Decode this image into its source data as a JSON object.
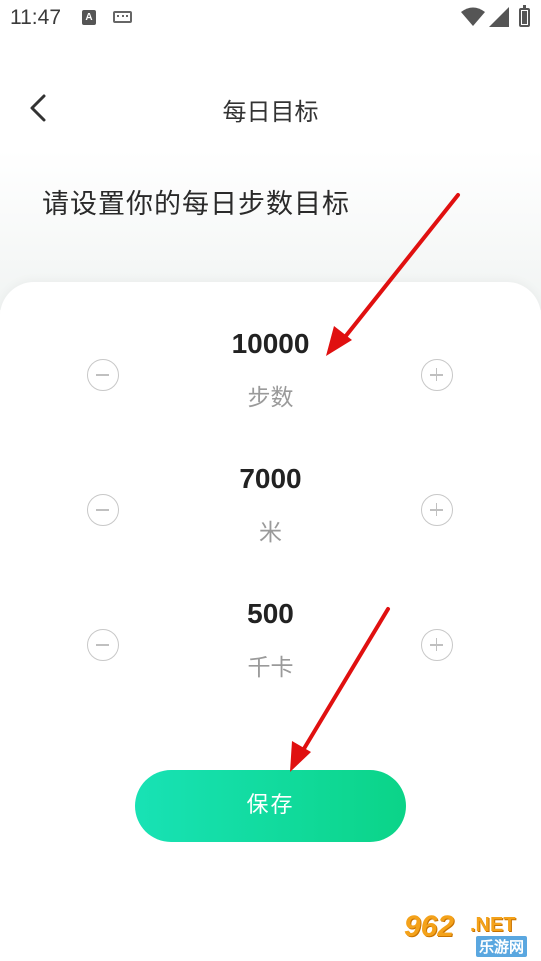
{
  "status_bar": {
    "time": "11:47",
    "notification_icon_text": "A"
  },
  "header": {
    "title": "每日目标"
  },
  "prompt": "请设置你的每日步数目标",
  "goals": [
    {
      "value": "10000",
      "unit": "步数"
    },
    {
      "value": "7000",
      "unit": "米"
    },
    {
      "value": "500",
      "unit": "千卡"
    }
  ],
  "save_label": "保存",
  "watermark": {
    "number": "962",
    "suffix": ".NET",
    "chinese": "乐游网"
  },
  "colors": {
    "accent_start": "#18e2b5",
    "accent_end": "#0bd488",
    "annotation_arrow": "#e01010",
    "watermark_orange": "#f4a21a"
  }
}
